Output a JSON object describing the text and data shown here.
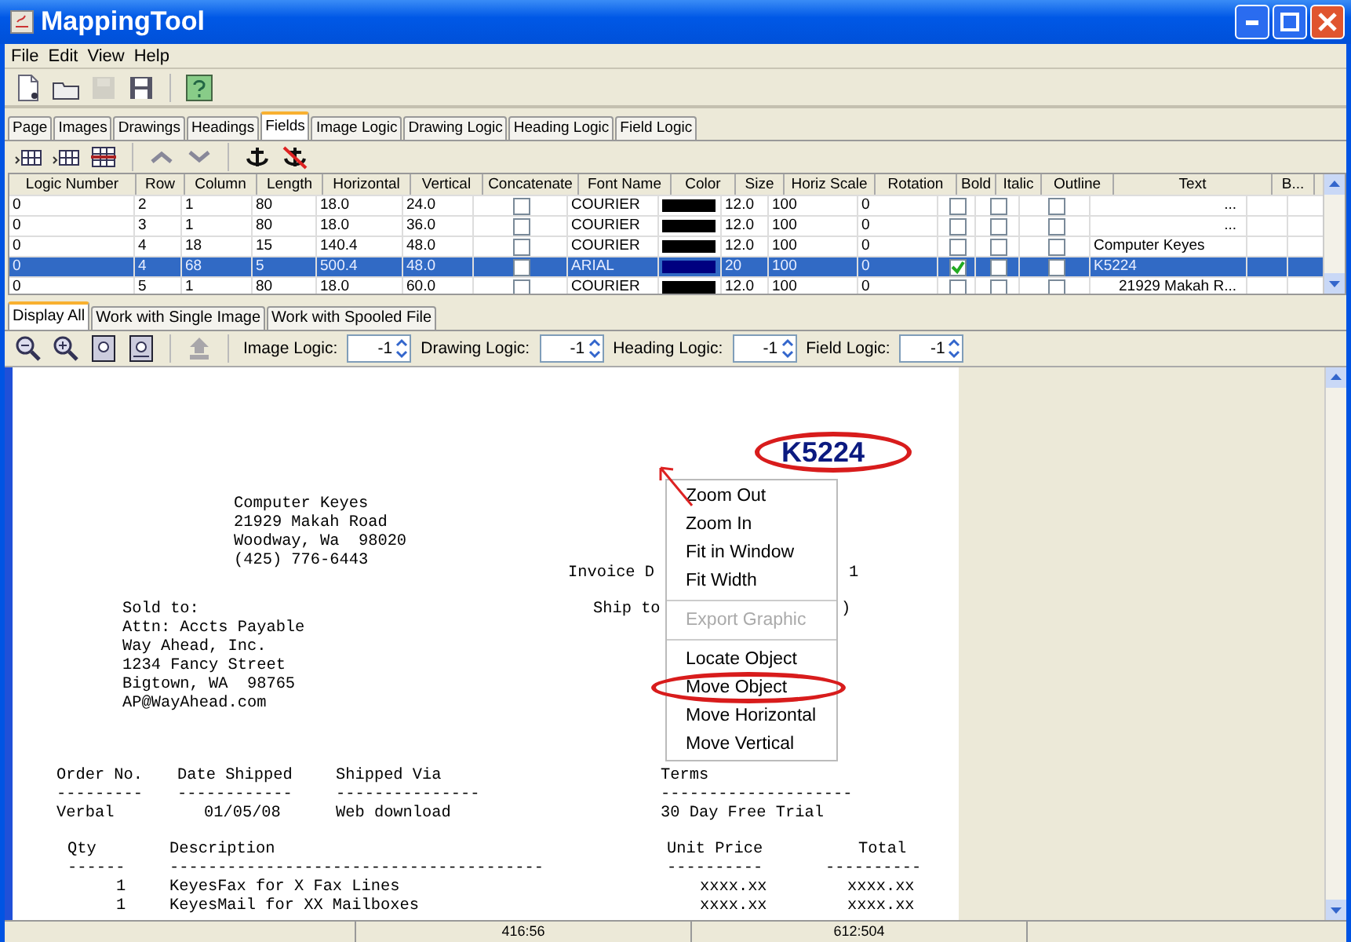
{
  "window": {
    "title": "MappingTool"
  },
  "menu": [
    "File",
    "Edit",
    "View",
    "Help"
  ],
  "toolbar": [
    {
      "kind": "new",
      "disabled": false
    },
    {
      "kind": "open",
      "disabled": false
    },
    {
      "kind": "save",
      "disabled": true
    },
    {
      "kind": "save-as",
      "disabled": false
    },
    {
      "kind": "help",
      "disabled": false
    }
  ],
  "tabs": [
    {
      "label": "Page",
      "selected": false
    },
    {
      "label": "Images",
      "selected": false
    },
    {
      "label": "Drawings",
      "selected": false
    },
    {
      "label": "Headings",
      "selected": false
    },
    {
      "label": "Fields",
      "selected": true
    },
    {
      "label": "Image Logic",
      "selected": false
    },
    {
      "label": "Drawing Logic",
      "selected": false
    },
    {
      "label": "Heading Logic",
      "selected": false
    },
    {
      "label": "Field Logic",
      "selected": false
    }
  ],
  "field_toolbar": [
    {
      "kind": "add-row"
    },
    {
      "kind": "insert-row"
    },
    {
      "kind": "delete-row"
    },
    {
      "kind": "up"
    },
    {
      "kind": "down"
    },
    {
      "kind": "anchor"
    },
    {
      "kind": "unanchor"
    }
  ],
  "table": {
    "columns": [
      {
        "label": "Logic Number",
        "kind": "text"
      },
      {
        "label": "Row",
        "kind": "text"
      },
      {
        "label": "Column",
        "kind": "text"
      },
      {
        "label": "Length",
        "kind": "text"
      },
      {
        "label": "Horizontal",
        "kind": "text"
      },
      {
        "label": "Vertical",
        "kind": "text"
      },
      {
        "label": "Concatenate",
        "kind": "check"
      },
      {
        "label": "Font Name",
        "kind": "text"
      },
      {
        "label": "Color",
        "kind": "color"
      },
      {
        "label": "Size",
        "kind": "text"
      },
      {
        "label": "Horiz Scale",
        "kind": "text"
      },
      {
        "label": "Rotation",
        "kind": "text"
      },
      {
        "label": "Bold",
        "kind": "check"
      },
      {
        "label": "Italic",
        "kind": "check"
      },
      {
        "label": "Outline",
        "kind": "check"
      },
      {
        "label": "Text",
        "kind": "text"
      },
      {
        "label": "B...",
        "kind": "text"
      }
    ],
    "rows": [
      {
        "selected": false,
        "truncated": true,
        "color": "#000000",
        "cells": [
          "0",
          "2",
          "1",
          "80",
          "18.0",
          "24.0",
          false,
          "COURIER",
          null,
          "12.0",
          "100",
          "0",
          false,
          false,
          false,
          "...",
          null
        ]
      },
      {
        "selected": false,
        "truncated": true,
        "color": "#000000",
        "cells": [
          "0",
          "3",
          "1",
          "80",
          "18.0",
          "36.0",
          false,
          "COURIER",
          null,
          "12.0",
          "100",
          "0",
          false,
          false,
          false,
          "...",
          null
        ]
      },
      {
        "selected": false,
        "truncated": false,
        "color": "#000000",
        "cells": [
          "0",
          "4",
          "18",
          "15",
          "140.4",
          "48.0",
          false,
          "COURIER",
          null,
          "12.0",
          "100",
          "0",
          false,
          false,
          false,
          "Computer Keyes",
          null
        ]
      },
      {
        "selected": true,
        "truncated": false,
        "color": "#000080",
        "cells": [
          "0",
          "4",
          "68",
          "5",
          "500.4",
          "48.0",
          false,
          "ARIAL",
          null,
          "20",
          "100",
          "0",
          true,
          false,
          false,
          "K5224",
          null
        ]
      },
      {
        "selected": false,
        "truncated": true,
        "color": "#000000",
        "cells": [
          "0",
          "5",
          "1",
          "80",
          "18.0",
          "60.0",
          false,
          "COURIER",
          null,
          "12.0",
          "100",
          "0",
          false,
          false,
          false,
          "21929 Makah R...",
          null
        ]
      }
    ]
  },
  "view_tabs": [
    {
      "label": "Display All",
      "selected": true
    },
    {
      "label": "Work with Single Image",
      "selected": false
    },
    {
      "label": "Work with Spooled File",
      "selected": false
    }
  ],
  "view_toolbar": [
    {
      "kind": "zoom-out",
      "disabled": false
    },
    {
      "kind": "zoom-in",
      "disabled": false
    },
    {
      "kind": "fit-page",
      "disabled": false
    },
    {
      "kind": "fit-width",
      "disabled": false
    },
    {
      "kind": "upload",
      "disabled": true
    }
  ],
  "spinners": [
    {
      "label": "Image Logic:",
      "value": "-1"
    },
    {
      "label": "Drawing Logic:",
      "value": "-1"
    },
    {
      "label": "Heading Logic:",
      "value": "-1"
    },
    {
      "label": "Field Logic:",
      "value": "-1"
    }
  ],
  "document": {
    "sender": [
      "Computer Keyes",
      "21929 Makah Road",
      "Woodway, Wa  98020",
      "(425) 776-6443"
    ],
    "field_value": {
      "text": "K5224",
      "circled": true
    },
    "invoice_date": [
      "Invoice D",
      "1"
    ],
    "ship_to": [
      "Ship to",
      ")"
    ],
    "sold_to": [
      "Sold to:",
      "Attn: Accts Payable",
      "Way Ahead, Inc.",
      "1234 Fancy Street",
      "Bigtown, WA  98765",
      "AP@WayAhead.com"
    ],
    "order_table": [
      [
        "Order No.",
        "Date Shipped",
        "Shipped Via",
        "Terms"
      ],
      [
        "---------",
        "------------",
        "---------------",
        "--------------------"
      ],
      [
        "Verbal",
        "01/05/08",
        "Web download",
        "30 Day Free Trial"
      ]
    ],
    "items_table": [
      [
        "Qty",
        "Description",
        "Unit Price",
        "Total"
      ],
      [
        "------",
        "---------------------------------------",
        "----------",
        "----------"
      ],
      [
        "1",
        "KeyesFax for X Fax Lines",
        "xxxx.xx",
        "xxxx.xx"
      ],
      [
        "1",
        "KeyesMail for XX Mailboxes",
        "xxxx.xx",
        "xxxx.xx"
      ]
    ]
  },
  "context_menu": [
    {
      "kind": "item",
      "label": "Zoom Out",
      "disabled": false,
      "circled": false
    },
    {
      "kind": "item",
      "label": "Zoom In",
      "disabled": false,
      "circled": false
    },
    {
      "kind": "item",
      "label": "Fit in Window",
      "disabled": false,
      "circled": false
    },
    {
      "kind": "item",
      "label": "Fit Width",
      "disabled": false,
      "circled": false
    },
    {
      "kind": "separator"
    },
    {
      "kind": "item",
      "label": "Export Graphic",
      "disabled": true,
      "circled": false
    },
    {
      "kind": "separator"
    },
    {
      "kind": "item",
      "label": "Locate Object",
      "disabled": false,
      "circled": false
    },
    {
      "kind": "item",
      "label": "Move Object",
      "disabled": false,
      "circled": true
    },
    {
      "kind": "item",
      "label": "Move Horizontal",
      "disabled": false,
      "circled": false
    },
    {
      "kind": "item",
      "label": "Move Vertical",
      "disabled": false,
      "circled": false
    }
  ],
  "status_bar": [
    "416:56",
    "612:504"
  ]
}
